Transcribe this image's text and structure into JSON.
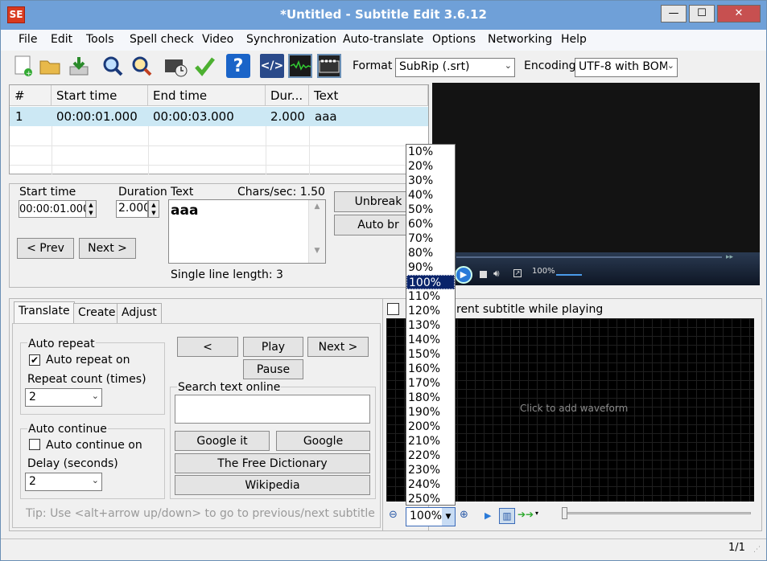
{
  "window": {
    "title": "*Untitled - Subtitle Edit 3.6.12",
    "app_icon_text": "SE"
  },
  "caption_buttons": {
    "minimize": "—",
    "maximize": "☐",
    "close": "✕"
  },
  "menu": [
    "File",
    "Edit",
    "Tools",
    "Spell check",
    "Video",
    "Synchronization",
    "Auto-translate",
    "Options",
    "Networking",
    "Help"
  ],
  "toolbar": {
    "format_label": "Format",
    "format_value": "SubRip (.srt)",
    "encoding_label": "Encoding",
    "encoding_value": "UTF-8 with BOM"
  },
  "grid": {
    "headers": [
      "#",
      "Start time",
      "End time",
      "Dur...",
      "Text"
    ],
    "rows": [
      [
        "1",
        "00:00:01.000",
        "00:00:03.000",
        "2.000",
        "aaa"
      ]
    ]
  },
  "editor": {
    "start_time_label": "Start time",
    "start_time_value": "00:00:01.000",
    "duration_label": "Duration",
    "duration_value": "2.000",
    "text_label": "Text",
    "chars_sec": "Chars/sec: 1.50",
    "text_value": "aaa",
    "single_line_length": "Single line length: 3",
    "prev": "< Prev",
    "next": "Next >",
    "unbreak": "Unbreak",
    "auto_br": "Auto br"
  },
  "video": {
    "volume_text": "100%"
  },
  "zoom_dropdown": {
    "options": [
      "10%",
      "20%",
      "30%",
      "40%",
      "50%",
      "60%",
      "70%",
      "80%",
      "90%",
      "100%",
      "110%",
      "120%",
      "130%",
      "140%",
      "150%",
      "160%",
      "170%",
      "180%",
      "190%",
      "200%",
      "210%",
      "220%",
      "230%",
      "240%",
      "250%"
    ],
    "selected": "100%"
  },
  "tabs": [
    "Translate",
    "Create",
    "Adjust"
  ],
  "translate": {
    "auto_repeat_title": "Auto repeat",
    "auto_repeat_on": "Auto repeat on",
    "auto_repeat_checked": true,
    "repeat_count_label": "Repeat count (times)",
    "repeat_count_value": "2",
    "auto_continue_title": "Auto continue",
    "auto_continue_on": "Auto continue on",
    "auto_continue_checked": false,
    "delay_label": "Delay (seconds)",
    "delay_value": "2",
    "prev_btn": "<",
    "play_btn": "Play",
    "next_btn": "Next >",
    "pause_btn": "Pause",
    "search_title": "Search text online",
    "google_it": "Google it",
    "google": "Google",
    "free_dictionary": "The Free Dictionary",
    "wikipedia": "Wikipedia",
    "tip": "Tip: Use <alt+arrow up/down> to go to previous/next subtitle"
  },
  "waveform": {
    "select_current_label": "Select current subtitle while playing",
    "select_current_visible": "rent subtitle while playing",
    "placeholder": "Click to add waveform",
    "zoom_value": "100%"
  },
  "status": {
    "position": "1/1"
  }
}
